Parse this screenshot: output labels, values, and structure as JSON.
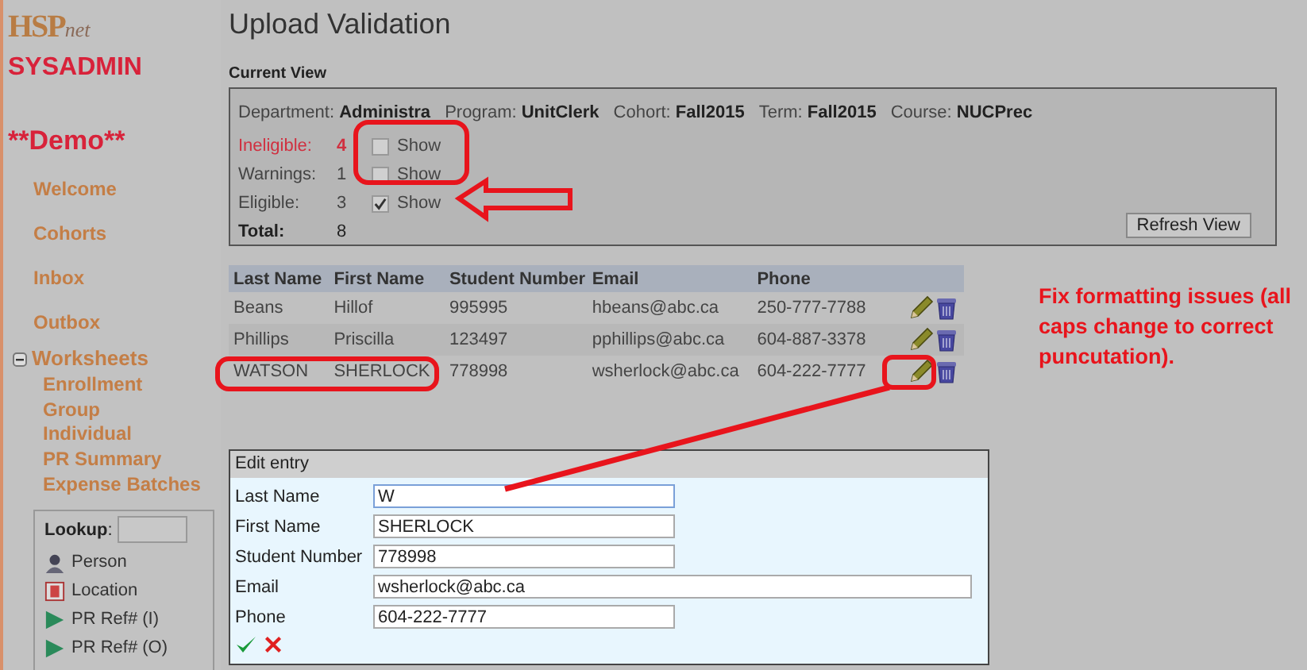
{
  "sidebar": {
    "logo": {
      "main": "HSP",
      "sub": "net"
    },
    "role": "SYSADMIN",
    "context": "**Demo**",
    "nav": [
      {
        "label": "Welcome"
      },
      {
        "label": "Cohorts"
      },
      {
        "label": "Inbox"
      },
      {
        "label": "Outbox"
      }
    ],
    "worksheets": {
      "label": "Worksheets",
      "expanded": true,
      "children": [
        {
          "label": "Enrollment"
        },
        {
          "label": "Group"
        },
        {
          "label": "Individual"
        },
        {
          "label": "PR Summary"
        },
        {
          "label": "Expense Batches"
        }
      ]
    },
    "lookup": {
      "label": "Lookup",
      "colon": ":",
      "items": [
        {
          "label": "Person",
          "kind": "person"
        },
        {
          "label": "Location",
          "kind": "location"
        },
        {
          "label": "PR Ref# (I)",
          "kind": "ref"
        },
        {
          "label": "PR Ref# (O)",
          "kind": "ref"
        }
      ]
    }
  },
  "page_title": "Upload Validation",
  "current_view": {
    "heading": "Current View",
    "filters": [
      {
        "label": "Department:",
        "value": "Administra"
      },
      {
        "label": "Program:",
        "value": "UnitClerk"
      },
      {
        "label": "Cohort:",
        "value": "Fall2015"
      },
      {
        "label": "Term:",
        "value": "Fall2015"
      },
      {
        "label": "Course:",
        "value": "NUCPrec"
      }
    ],
    "counts": [
      {
        "label": "Ineligible:",
        "value": "4",
        "kind": "error",
        "show": {
          "label": "Show",
          "checked": false
        }
      },
      {
        "label": "Warnings:",
        "value": "1",
        "kind": "plain",
        "show": {
          "label": "Show",
          "checked": false
        }
      },
      {
        "label": "Eligible:",
        "value": "3",
        "kind": "plain",
        "show": {
          "label": "Show",
          "checked": true
        }
      },
      {
        "label": "Total:",
        "value": "8",
        "kind": "total"
      }
    ],
    "refresh_button": "Refresh View"
  },
  "table": {
    "columns": [
      "Last Name",
      "First Name",
      "Student Number",
      "Email",
      "Phone"
    ],
    "rows": [
      [
        "Beans",
        "Hillof",
        "995995",
        "hbeans@abc.ca",
        "250-777-7788"
      ],
      [
        "Phillips",
        "Priscilla",
        "123497",
        "pphillips@abc.ca",
        "604-887-3378"
      ],
      [
        "WATSON",
        "SHERLOCK",
        "778998",
        "wsherlock@abc.ca",
        "604-222-7777"
      ]
    ]
  },
  "edit_entry": {
    "title": "Edit entry",
    "fields": [
      {
        "label": "Last Name",
        "value": "W",
        "wide": false
      },
      {
        "label": "First Name",
        "value": "SHERLOCK",
        "wide": false
      },
      {
        "label": "Student Number",
        "value": "778998",
        "wide": false
      },
      {
        "label": "Email",
        "value": "wsherlock@abc.ca",
        "wide": true
      },
      {
        "label": "Phone",
        "value": "604-222-7777",
        "wide": false
      }
    ]
  },
  "annotation_note": "Fix formatting issues (all caps change to correct puncutation)."
}
